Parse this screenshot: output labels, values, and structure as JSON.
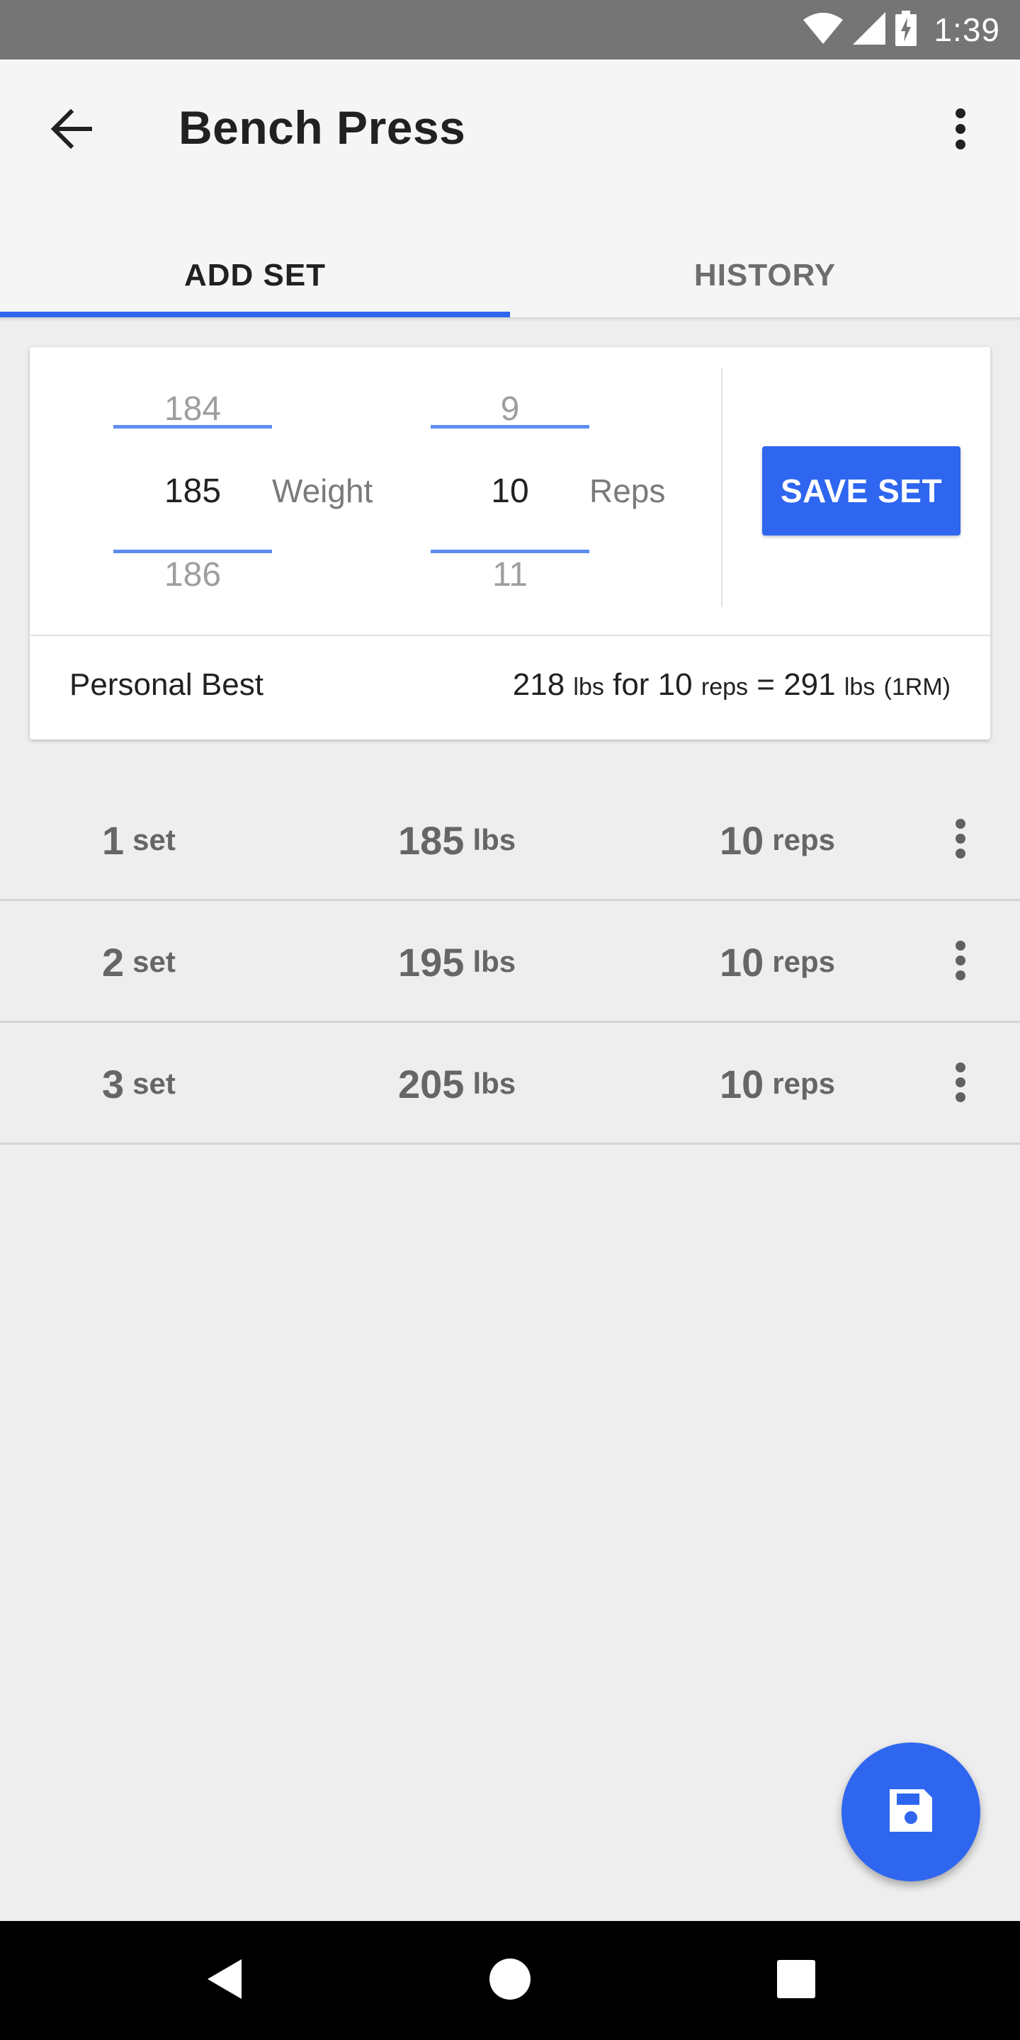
{
  "status": {
    "time": "1:39",
    "icons": [
      "wifi-icon",
      "cell-signal-icon",
      "battery-charging-icon"
    ]
  },
  "appbar": {
    "title": "Bench Press",
    "icons": {
      "back": "arrow-back-icon",
      "menu": "more-vert-icon"
    }
  },
  "tabs": [
    {
      "label": "ADD SET",
      "active": true
    },
    {
      "label": "HISTORY",
      "active": false
    }
  ],
  "colors": {
    "accent": "#2f66f0",
    "appbar": "#f5f5f5",
    "background": "#eeeeee",
    "statusbar": "#757575"
  },
  "weight_picker": {
    "prev": "184",
    "current": "185",
    "next": "186",
    "label": "Weight"
  },
  "reps_picker": {
    "prev": "9",
    "current": "10",
    "next": "11",
    "label": "Reps"
  },
  "save_set_label": "SAVE SET",
  "personal_best": {
    "label": "Personal Best",
    "weight": "218",
    "weight_unit": "lbs",
    "for_text": "for",
    "reps": "10",
    "reps_unit": "reps",
    "equals": "=",
    "one_rm": "291",
    "one_rm_unit": "lbs",
    "one_rm_suffix": "(1RM)"
  },
  "sets": [
    {
      "number": "1",
      "number_unit": "set",
      "weight": "185",
      "weight_unit": "lbs",
      "reps": "10",
      "reps_unit": "reps"
    },
    {
      "number": "2",
      "number_unit": "set",
      "weight": "195",
      "weight_unit": "lbs",
      "reps": "10",
      "reps_unit": "reps"
    },
    {
      "number": "3",
      "number_unit": "set",
      "weight": "205",
      "weight_unit": "lbs",
      "reps": "10",
      "reps_unit": "reps"
    }
  ],
  "fab_icon": "save-icon",
  "navbar": {
    "icons": [
      "nav-back-icon",
      "nav-home-icon",
      "nav-recents-icon"
    ]
  }
}
